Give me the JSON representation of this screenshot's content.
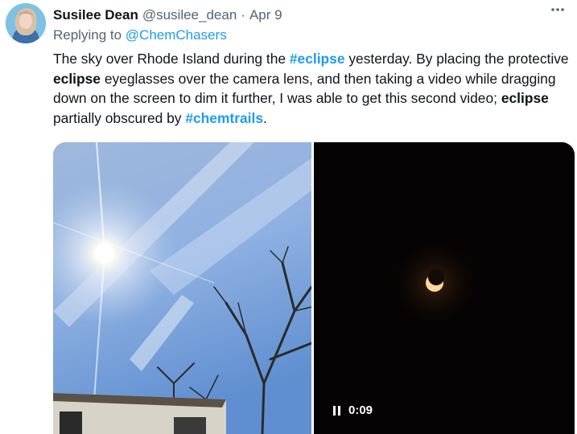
{
  "author": {
    "name": "Susilee Dean",
    "handle": "@susilee_dean",
    "separator": "·",
    "date": "Apr 9",
    "avatar_icon": "user-avatar"
  },
  "reply": {
    "prefix": "Replying to",
    "mention": "@ChemChasers"
  },
  "tweet": {
    "segments": [
      {
        "t": "The sky over Rhode Island during the ",
        "kind": "text"
      },
      {
        "t": "#eclipse",
        "kind": "hashtag"
      },
      {
        "t": " yesterday. By placing the protective ",
        "kind": "text"
      },
      {
        "t": "eclipse",
        "kind": "bold"
      },
      {
        "t": " eyeglasses over the camera lens, and then taking a video while dragging down on the screen to dim it further, I was able to get this second video; ",
        "kind": "text"
      },
      {
        "t": "eclipse",
        "kind": "bold"
      },
      {
        "t": " partially obscured by ",
        "kind": "text"
      },
      {
        "t": "#chemtrails",
        "kind": "hashtag"
      },
      {
        "t": ".",
        "kind": "text"
      }
    ]
  },
  "media": {
    "photo_icon": "sky-photo",
    "video": {
      "timestamp": "0:09",
      "control_icon": "pause-icon"
    }
  },
  "more_icon": "more-options-icon",
  "colors": {
    "accent": "#1d9bf0",
    "text": "#0f1419",
    "muted": "#536471"
  }
}
